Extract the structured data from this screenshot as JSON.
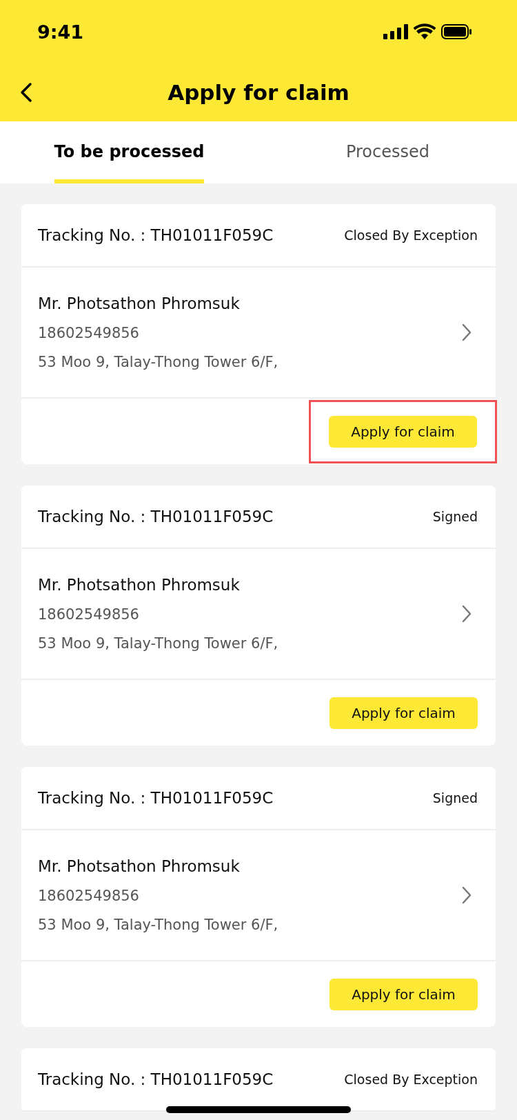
{
  "status_bar": {
    "time": "9:41"
  },
  "header": {
    "title": "Apply for claim"
  },
  "tabs": [
    {
      "label": "To be processed",
      "selected": true
    },
    {
      "label": "Processed",
      "selected": false
    }
  ],
  "cards": [
    {
      "tracking": "Tracking No. : TH01011F059C",
      "status": "Closed By Exception",
      "name": "Mr. Photsathon Phromsuk",
      "phone": "18602549856",
      "address": "53 Moo 9, Talay-Thong Tower 6/F,",
      "button": "Apply for claim",
      "highlighted": true
    },
    {
      "tracking": "Tracking No. : TH01011F059C",
      "status": "Signed",
      "name": "Mr. Photsathon Phromsuk",
      "phone": "18602549856",
      "address": "53 Moo 9, Talay-Thong Tower 6/F,",
      "button": "Apply for claim",
      "highlighted": false
    },
    {
      "tracking": "Tracking No. : TH01011F059C",
      "status": "Signed",
      "name": "Mr. Photsathon Phromsuk",
      "phone": "18602549856",
      "address": "53 Moo 9, Talay-Thong Tower 6/F,",
      "button": "Apply for claim",
      "highlighted": false
    },
    {
      "tracking": "Tracking No. : TH01011F059C",
      "status": "Closed By Exception"
    }
  ]
}
